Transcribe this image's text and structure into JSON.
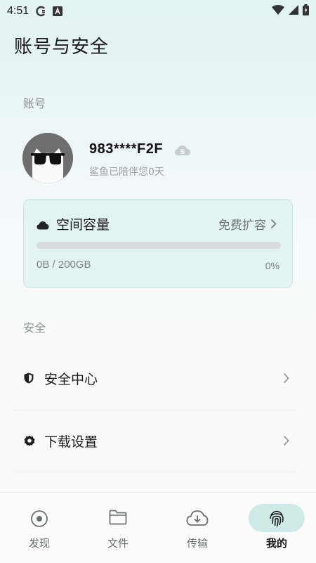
{
  "status_bar": {
    "time": "4:51",
    "icons": [
      "sync-icon",
      "font-icon",
      "wifi-icon",
      "signal-icon",
      "battery-icon"
    ]
  },
  "page": {
    "title": "账号与安全"
  },
  "account": {
    "section_label": "账号",
    "username": "983****F2F",
    "days_text": "鲨鱼已陪伴您0天",
    "badge_icon": "vip-cloud-badge-icon"
  },
  "storage": {
    "title": "空间容量",
    "expand_label": "免费扩容",
    "usage": "0B / 200GB",
    "percent": "0%",
    "percent_value": 0,
    "accent": "#4fb6b0"
  },
  "security": {
    "section_label": "安全",
    "items": [
      {
        "label": "安全中心",
        "icon": "shield-icon"
      },
      {
        "label": "下载设置",
        "icon": "gear-icon"
      }
    ]
  },
  "bottom_nav": {
    "items": [
      {
        "label": "发现",
        "icon": "discover-icon",
        "active": false
      },
      {
        "label": "文件",
        "icon": "folder-icon",
        "active": false
      },
      {
        "label": "传输",
        "icon": "cloud-download-icon",
        "active": false
      },
      {
        "label": "我的",
        "icon": "fingerprint-icon",
        "active": true
      }
    ],
    "active_color": "#cfe9e8"
  }
}
